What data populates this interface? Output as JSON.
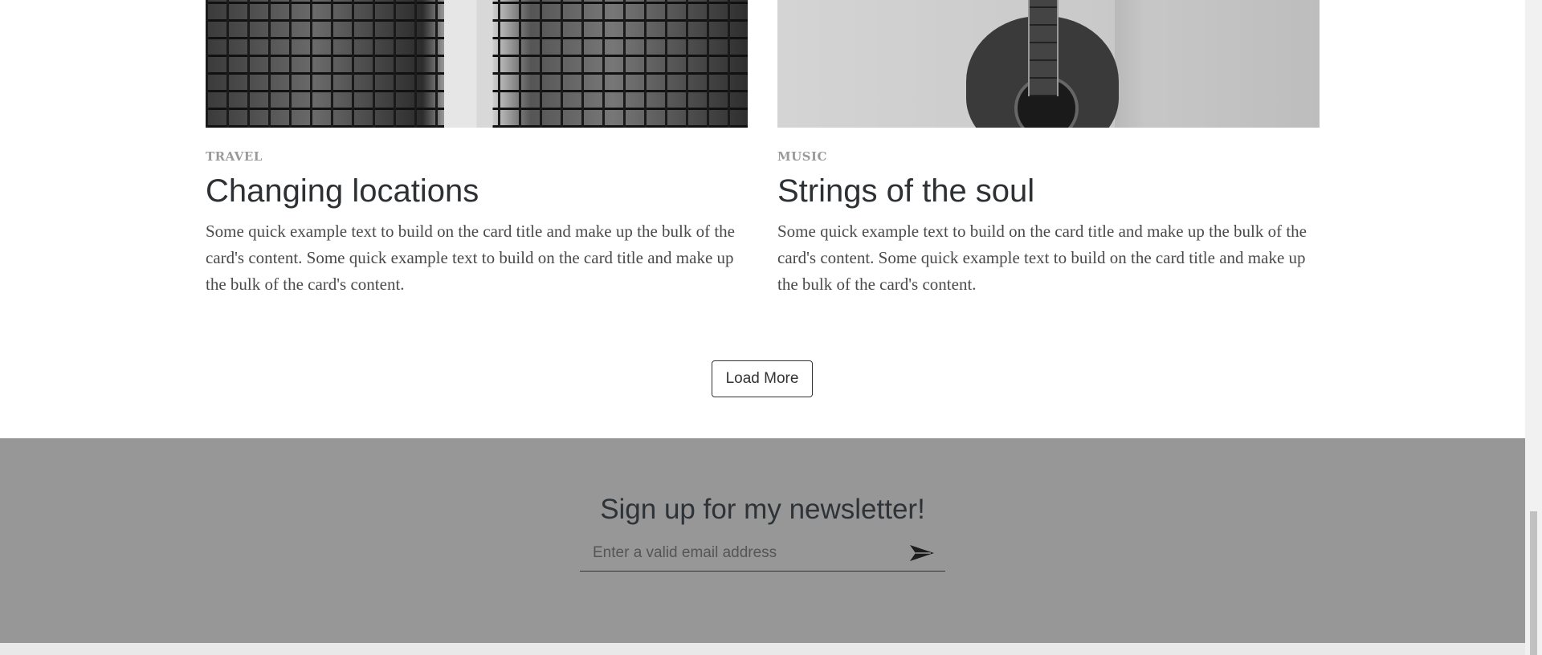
{
  "cards": [
    {
      "image_alt": "glass-skyscrapers",
      "category": "TRAVEL",
      "title": "Changing locations",
      "text": "Some quick example text to build on the card title and make up the bulk of the card's content. Some quick example text to build on the card title and make up the bulk of the card's content."
    },
    {
      "image_alt": "acoustic-guitar",
      "category": "MUSIC",
      "title": "Strings of the soul",
      "text": "Some quick example text to build on the card title and make up the bulk of the card's content. Some quick example text to build on the card title and make up the bulk of the card's content."
    }
  ],
  "load_more_label": "Load More",
  "newsletter": {
    "title": "Sign up for my newsletter!",
    "email_placeholder": "Enter a valid email address",
    "email_value": "",
    "submit_icon": "send-arrow-icon"
  },
  "colors": {
    "newsletter_bg": "#979797",
    "title_text": "#2d3134",
    "category_text": "#9a9a9a"
  }
}
